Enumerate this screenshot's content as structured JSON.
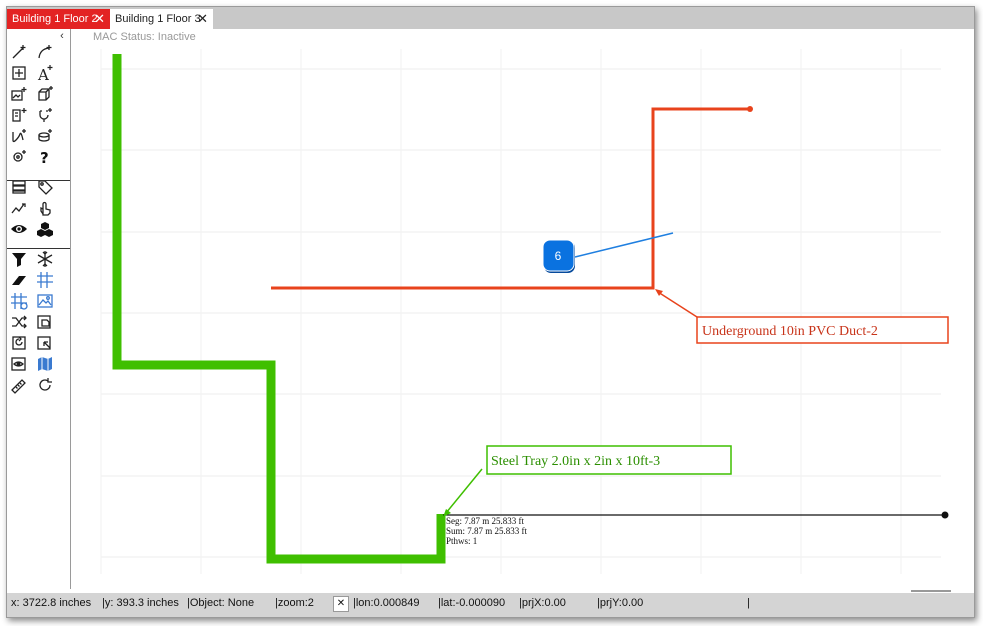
{
  "tabs": [
    {
      "label": "Building 1 Floor 2",
      "close": "✕"
    },
    {
      "label": "Building 1 Floor 3",
      "close": "✕"
    }
  ],
  "toolbar": {
    "collapse": "‹",
    "tools": [
      "draw-line-icon",
      "draw-arc-icon",
      "move-icon",
      "add-text-icon",
      "add-image-icon",
      "add-box-icon",
      "add-rack-icon",
      "add-connector-icon",
      "add-path-icon",
      "add-cylinder-icon",
      "add-location-icon",
      "help-icon",
      "layers-icon",
      "tag-icon",
      "trace-icon",
      "pan-hand-icon",
      "visibility-icon",
      "objects-icon",
      "filter-icon",
      "snowflake-icon",
      "eraser-icon",
      "grid-icon",
      "grid-settings-icon",
      "background-image-icon",
      "shuffle-icon",
      "export-object-icon",
      "rotate-object-icon",
      "select-object-icon",
      "view-icon",
      "map-icon",
      "measure-icon",
      "refresh-icon"
    ]
  },
  "header": {
    "mac_status": "MAC Status: Inactive"
  },
  "canvas": {
    "marker_label": "6",
    "duct_label": "Underground 10in PVC Duct-2",
    "tray_label": "Steel Tray 2.0in x 2in x 10ft-3",
    "measure_lines": [
      "Seg: 7.87 m 25.833 ft",
      "Sum: 7.87 m 25.833 ft",
      "Pthws: 1"
    ],
    "colors": {
      "tray": "#3fbf00",
      "duct": "#e8431c",
      "marker": "#0a72e0",
      "blue_line": "#1f7fe0"
    }
  },
  "status": {
    "x": "x: 3722.8 inches",
    "y": "|y: 393.3 inches",
    "object": "|Object: None",
    "zoom": "|zoom:2",
    "zoom_reset": "✕",
    "lon": "|lon:0.000849",
    "lat": "|lat:-0.000090",
    "prjx": "|prjX:0.00",
    "prjy": "|prjY:0.00",
    "end": "|"
  }
}
